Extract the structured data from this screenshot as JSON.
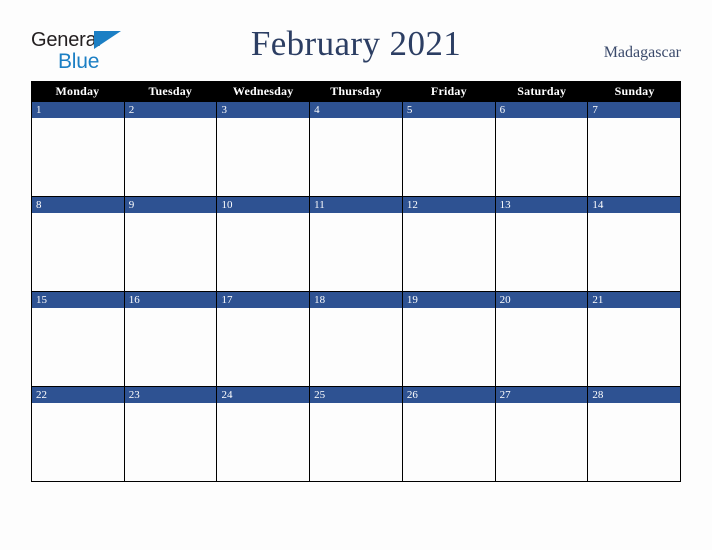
{
  "brand": {
    "line1": "General",
    "line2": "Blue",
    "triangle_icon": "brand-triangle-icon",
    "color_dark": "#231f20",
    "color_blue": "#1c7fc4"
  },
  "header": {
    "title": "February 2021",
    "country": "Madagascar",
    "title_color": "#2c3e63"
  },
  "calendar": {
    "weekday_headers": [
      "Monday",
      "Tuesday",
      "Wednesday",
      "Thursday",
      "Friday",
      "Saturday",
      "Sunday"
    ],
    "header_bg": "#000000",
    "header_text": "#ffffff",
    "date_band_bg": "#2e5292",
    "date_text": "#ffffff",
    "cell_bg": "#fdfdfd",
    "border_color": "#000000",
    "weeks": [
      {
        "days": [
          {
            "date": "1",
            "blank": false
          },
          {
            "date": "2",
            "blank": false
          },
          {
            "date": "3",
            "blank": false
          },
          {
            "date": "4",
            "blank": false
          },
          {
            "date": "5",
            "blank": false
          },
          {
            "date": "6",
            "blank": false
          },
          {
            "date": "7",
            "blank": false
          }
        ]
      },
      {
        "days": [
          {
            "date": "8",
            "blank": false
          },
          {
            "date": "9",
            "blank": false
          },
          {
            "date": "10",
            "blank": false
          },
          {
            "date": "11",
            "blank": false
          },
          {
            "date": "12",
            "blank": false
          },
          {
            "date": "13",
            "blank": false
          },
          {
            "date": "14",
            "blank": false
          }
        ]
      },
      {
        "days": [
          {
            "date": "15",
            "blank": false
          },
          {
            "date": "16",
            "blank": false
          },
          {
            "date": "17",
            "blank": false
          },
          {
            "date": "18",
            "blank": false
          },
          {
            "date": "19",
            "blank": false
          },
          {
            "date": "20",
            "blank": false
          },
          {
            "date": "21",
            "blank": false
          }
        ]
      },
      {
        "days": [
          {
            "date": "22",
            "blank": false
          },
          {
            "date": "23",
            "blank": false
          },
          {
            "date": "24",
            "blank": false
          },
          {
            "date": "25",
            "blank": false
          },
          {
            "date": "26",
            "blank": false
          },
          {
            "date": "27",
            "blank": false
          },
          {
            "date": "28",
            "blank": false
          }
        ]
      }
    ]
  }
}
